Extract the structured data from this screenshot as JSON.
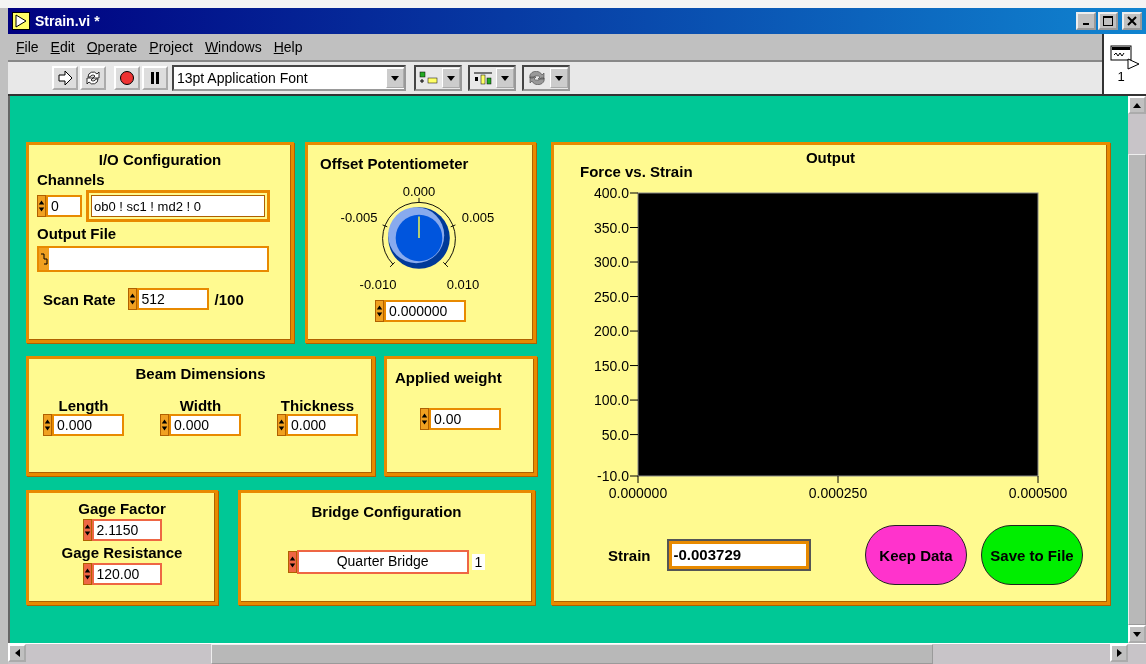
{
  "window": {
    "title": "Strain.vi *"
  },
  "menu": [
    "File",
    "Edit",
    "Operate",
    "Project",
    "Windows",
    "Help"
  ],
  "toolbar": {
    "font": "13pt Application Font"
  },
  "connector": {
    "label": "1"
  },
  "io_configuration": {
    "title": "I/O Configuration",
    "channels_label": "Channels",
    "channel_index": "0",
    "channels": "ob0 ! sc1 ! md2 ! 0",
    "output_file_label": "Output File",
    "scan_rate_label": "Scan Rate",
    "scan_rate": "512",
    "scan_rate_unit": "/100"
  },
  "offset_potentiometer": {
    "title": "Offset Potentiometer",
    "scale": [
      "-0.010",
      "-0.005",
      "0.000",
      "0.005",
      "0.010"
    ],
    "value": "0.000000"
  },
  "beam_dimensions": {
    "title": "Beam Dimensions",
    "fields": [
      {
        "label": "Length",
        "value": "0.000"
      },
      {
        "label": "Width",
        "value": "0.000"
      },
      {
        "label": "Thickness",
        "value": "0.000"
      }
    ]
  },
  "applied_weight": {
    "title": "Applied weight",
    "value": "0.00"
  },
  "gage": {
    "fields": [
      {
        "label": "Gage Factor",
        "value": "2.1150"
      },
      {
        "label": "Gage Resistance",
        "value": "120.00"
      }
    ]
  },
  "bridge_configuration": {
    "title": "Bridge Configuration",
    "value": "Quarter Bridge",
    "index": "1"
  },
  "output": {
    "title": "Output",
    "chart_data": {
      "type": "scatter",
      "title": "Force vs. Strain",
      "xlim": [
        0,
        0.0005
      ],
      "ylim": [
        -10,
        400
      ],
      "xticks": [
        {
          "value": 0,
          "label": "0.000000"
        },
        {
          "value": 0.00025,
          "label": "0.000250"
        },
        {
          "value": 0.0005,
          "label": "0.000500"
        }
      ],
      "yticks": [
        {
          "value": -10,
          "label": "-10.0"
        },
        {
          "value": 50,
          "label": "50.0"
        },
        {
          "value": 100,
          "label": "100.0"
        },
        {
          "value": 150,
          "label": "150.0"
        },
        {
          "value": 200,
          "label": "200.0"
        },
        {
          "value": 250,
          "label": "250.0"
        },
        {
          "value": 300,
          "label": "300.0"
        },
        {
          "value": 350,
          "label": "350.0"
        },
        {
          "value": 400,
          "label": "400.0"
        }
      ]
    },
    "strain_label": "Strain",
    "strain": "-0.003729",
    "buttons": [
      {
        "label": "Keep Data",
        "color": "#ff33cc"
      },
      {
        "label": "Save to File",
        "color": "#00ee00"
      }
    ]
  }
}
